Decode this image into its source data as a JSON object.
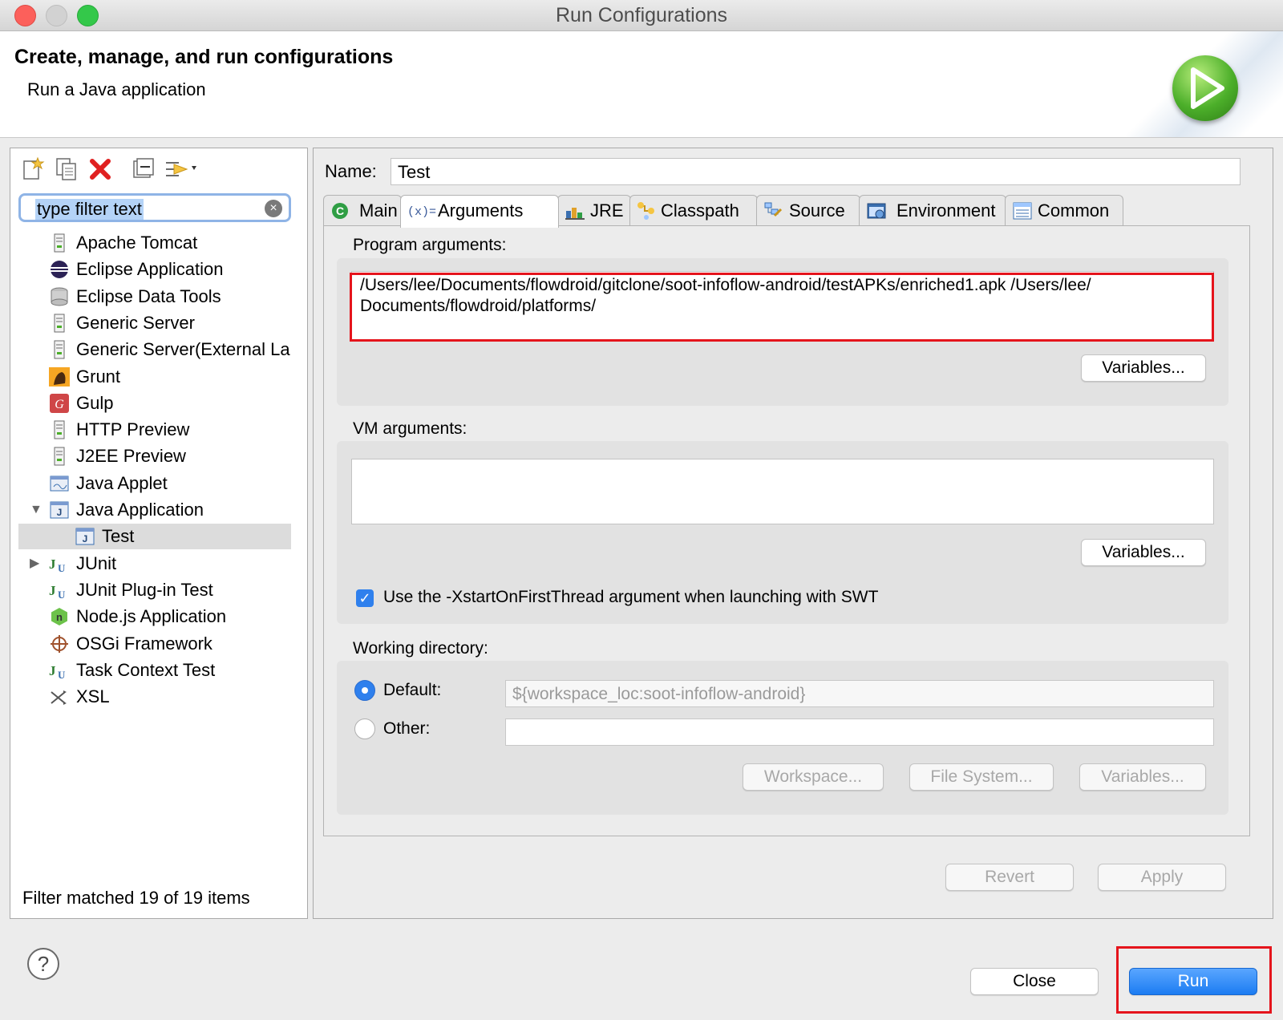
{
  "window": {
    "title": "Run Configurations"
  },
  "header": {
    "title": "Create, manage, and run configurations",
    "subtitle": "Run a Java application"
  },
  "left": {
    "filter_text": "type filter text",
    "tree": [
      {
        "label": "Apache Tomcat",
        "icon": "server-icon",
        "level": 0
      },
      {
        "label": "Eclipse Application",
        "icon": "eclipse-icon",
        "level": 0
      },
      {
        "label": "Eclipse Data Tools",
        "icon": "database-icon",
        "level": 0
      },
      {
        "label": "Generic Server",
        "icon": "server-icon",
        "level": 0
      },
      {
        "label": "Generic Server(External La",
        "icon": "server-icon",
        "level": 0
      },
      {
        "label": "Grunt",
        "icon": "grunt-icon",
        "level": 0
      },
      {
        "label": "Gulp",
        "icon": "gulp-icon",
        "level": 0
      },
      {
        "label": "HTTP Preview",
        "icon": "server-icon",
        "level": 0
      },
      {
        "label": "J2EE Preview",
        "icon": "server-icon",
        "level": 0
      },
      {
        "label": "Java Applet",
        "icon": "applet-icon",
        "level": 0
      },
      {
        "label": "Java Application",
        "icon": "java-app-icon",
        "level": 0,
        "expanded": true
      },
      {
        "label": "Test",
        "icon": "java-app-icon",
        "level": 1,
        "selected": true
      },
      {
        "label": "JUnit",
        "icon": "junit-icon",
        "level": 0,
        "collapsed": true
      },
      {
        "label": "JUnit Plug-in Test",
        "icon": "junit-icon",
        "level": 0
      },
      {
        "label": "Node.js Application",
        "icon": "nodejs-icon",
        "level": 0
      },
      {
        "label": "OSGi Framework",
        "icon": "osgi-icon",
        "level": 0
      },
      {
        "label": "Task Context Test",
        "icon": "junit-icon",
        "level": 0
      },
      {
        "label": "XSL",
        "icon": "xsl-icon",
        "level": 0
      }
    ],
    "status": "Filter matched 19 of 19 items"
  },
  "right": {
    "name_label": "Name:",
    "name_value": "Test",
    "tabs": [
      {
        "label": "Main",
        "icon": "main-icon"
      },
      {
        "label": "Arguments",
        "icon": "arguments-icon",
        "active": true
      },
      {
        "label": "JRE",
        "icon": "jre-icon"
      },
      {
        "label": "Classpath",
        "icon": "classpath-icon"
      },
      {
        "label": "Source",
        "icon": "source-icon"
      },
      {
        "label": "Environment",
        "icon": "environment-icon"
      },
      {
        "label": "Common",
        "icon": "common-icon"
      }
    ],
    "program_args_label": "Program arguments:",
    "program_args_value": "/Users/lee/Documents/flowdroid/gitclone/soot-infoflow-android/testAPKs/enriched1.apk /Users/lee/ Documents/flowdroid/platforms/",
    "variables_label": "Variables...",
    "vm_args_label": "VM arguments:",
    "vm_args_value": "",
    "xstart_label": "Use the -XstartOnFirstThread argument when launching with SWT",
    "xstart_checked": true,
    "workdir_label": "Working directory:",
    "default_label": "Default:",
    "default_value": "${workspace_loc:soot-infoflow-android}",
    "other_label": "Other:",
    "other_value": "",
    "workspace_label": "Workspace...",
    "filesystem_label": "File System...",
    "revert_label": "Revert",
    "apply_label": "Apply"
  },
  "footer": {
    "help": "?",
    "close_label": "Close",
    "run_label": "Run"
  },
  "colors": {
    "highlight_red": "#e5141c",
    "accent_blue": "#1b7cf2"
  }
}
